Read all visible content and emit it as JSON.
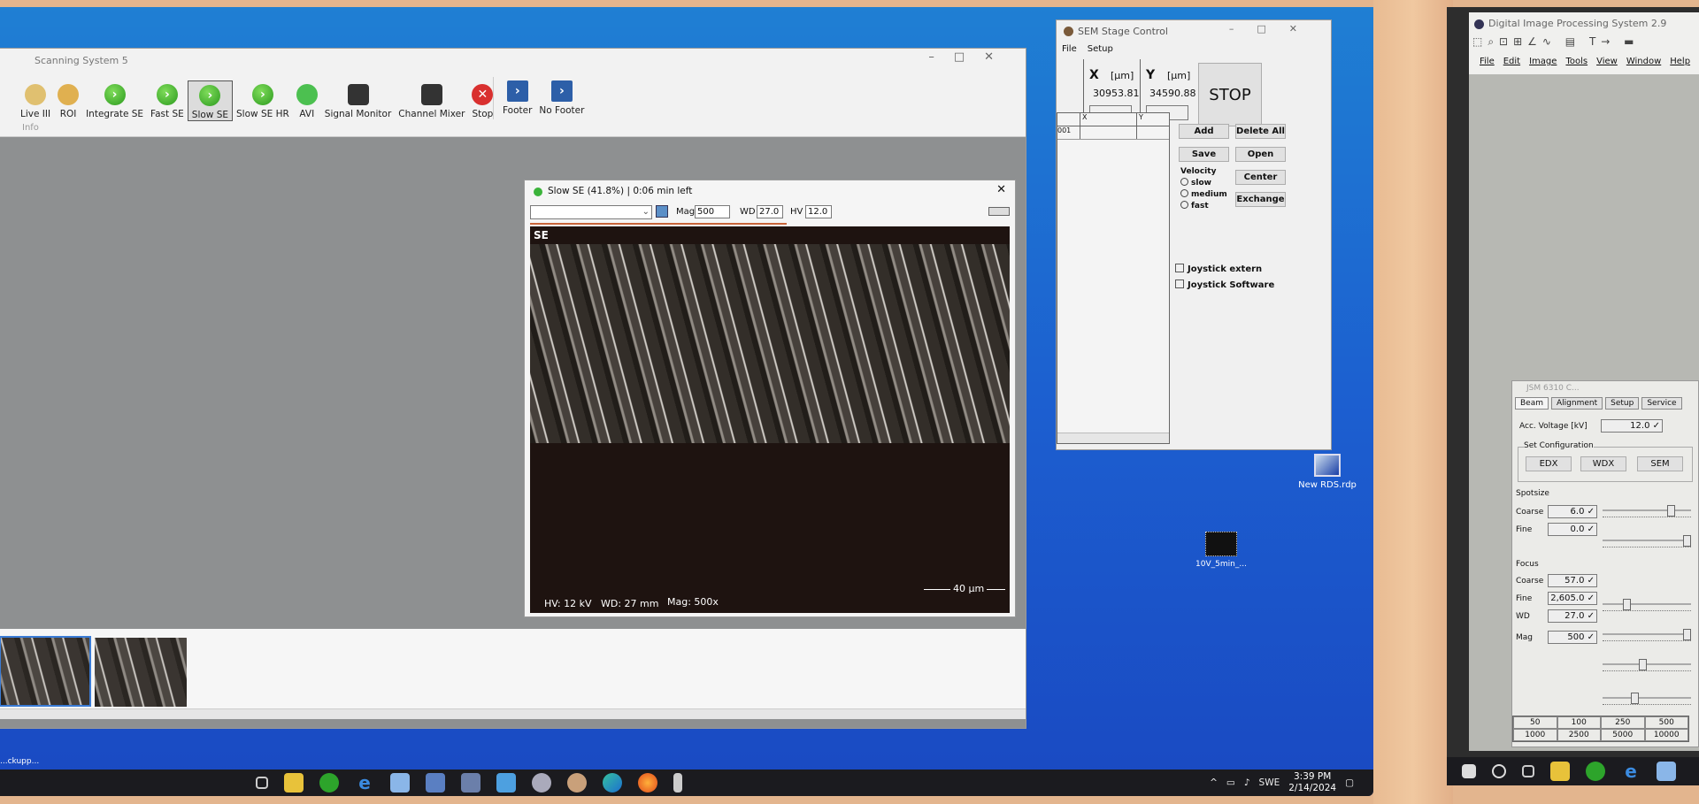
{
  "main_app": {
    "title": "Scanning System 5",
    "info_label": "Info",
    "toolbar": [
      {
        "label": "Live III",
        "icon": "live-icon"
      },
      {
        "label": "ROI",
        "icon": "roi-magnifier-icon"
      },
      {
        "label": "Integrate SE",
        "icon": "play-icon"
      },
      {
        "label": "Fast SE",
        "icon": "play-icon"
      },
      {
        "label": "Slow SE",
        "icon": "play-icon",
        "selected": true
      },
      {
        "label": "Slow SE HR",
        "icon": "play-icon"
      },
      {
        "label": "AVI",
        "icon": "video-camera-icon"
      },
      {
        "label": "Signal Monitor",
        "icon": "signal-monitor-icon"
      },
      {
        "label": "Channel Mixer",
        "icon": "mixer-icon"
      },
      {
        "label": "Stop",
        "icon": "stop-icon"
      }
    ],
    "toolbar2": [
      {
        "label": "Footer",
        "icon": "footer-icon"
      },
      {
        "label": "No Footer",
        "icon": "no-footer-icon"
      }
    ]
  },
  "image_window": {
    "title": "Slow SE (41.8%) | 0:06 min left",
    "progress_percent": 41.8,
    "mag_label": "Mag",
    "mag_value": "500",
    "wd_label": "WD",
    "wd_value": "27.0",
    "hv_label": "HV",
    "hv_value": "12.0",
    "channel_label": "SE",
    "footer": {
      "hv": "HV: 12 kV",
      "wd": "WD: 27 mm",
      "mag": "Mag: 500x",
      "scale": "40 µm"
    }
  },
  "stage_control": {
    "title": "SEM Stage Control",
    "menu": [
      "File",
      "Setup"
    ],
    "x_label": "X",
    "y_label": "Y",
    "unit": "[µm]",
    "x_value": "30953.81",
    "y_value": "34590.88",
    "x_input": "",
    "y_input": "",
    "stop_label": "STOP",
    "table": {
      "headers": [
        "",
        "X",
        "Y"
      ],
      "rows": [
        [
          "001",
          "",
          ""
        ]
      ]
    },
    "buttons": {
      "add": "Add",
      "delete_all": "Delete All",
      "save": "Save",
      "open": "Open",
      "center": "Center",
      "exchange": "Exchange"
    },
    "velocity_label": "Velocity",
    "velocity_options": [
      "slow",
      "medium",
      "fast"
    ],
    "joystick_extern": "Joystick extern",
    "joystick_software": "Joystick Software"
  },
  "desktop_icons": [
    {
      "label": "New RDS.rdp",
      "icon": "remote-desktop-icon"
    },
    {
      "label": "10V_5min_...",
      "icon": "image-file-icon"
    }
  ],
  "desktop_left_label": "...ckupp...",
  "taskbar_left": {
    "tray": {
      "language": "SWE",
      "time": "3:39 PM",
      "date": "2/14/2024"
    }
  },
  "dips": {
    "title": "Digital Image Processing System 2.9",
    "menu": [
      "File",
      "Edit",
      "Image",
      "Tools",
      "View",
      "Window",
      "Help"
    ]
  },
  "jsm": {
    "title": "JSM 6310 C...",
    "tabs": [
      "Beam",
      "Alignment",
      "Setup",
      "Service"
    ],
    "acc_voltage_label": "Acc. Voltage [kV]",
    "acc_voltage": "12.0 ✓",
    "set_config_label": "Set Configuration",
    "config_buttons": [
      "EDX",
      "WDX",
      "SEM"
    ],
    "spotsize_label": "Spotsize",
    "spot_coarse_label": "Coarse",
    "spot_coarse": "6.0 ✓",
    "spot_fine_label": "Fine",
    "spot_fine": "0.0 ✓",
    "focus_label": "Focus",
    "focus_coarse_label": "Coarse",
    "focus_coarse": "57.0 ✓",
    "focus_fine_label": "Fine",
    "focus_fine": "2,605.0 ✓",
    "wd_label": "WD",
    "wd": "27.0 ✓",
    "mag_label": "Mag",
    "mag": "500 ✓",
    "mag_presets": [
      "50",
      "100",
      "250",
      "500",
      "1000",
      "2500",
      "5000",
      "10000"
    ]
  }
}
